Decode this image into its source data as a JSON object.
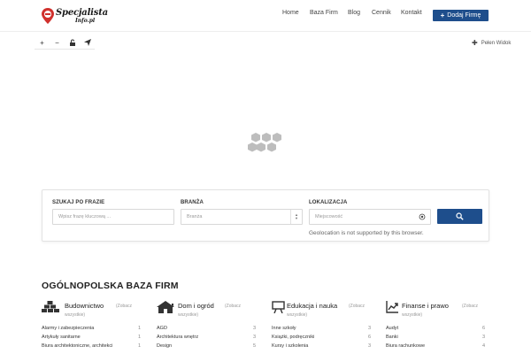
{
  "header": {
    "logo": {
      "line1": "Specjalista",
      "line2": "Info.pl"
    },
    "nav": [
      {
        "label": "Home"
      },
      {
        "label": "Baza Firm"
      },
      {
        "label": "Blog"
      },
      {
        "label": "Cennik"
      },
      {
        "label": "Kontakt"
      }
    ],
    "add_button": {
      "label": "Dodaj Firmę"
    }
  },
  "map": {
    "controls": [
      {
        "icon": "plus-icon",
        "glyph": "+"
      },
      {
        "icon": "minus-icon",
        "glyph": "−"
      },
      {
        "icon": "unlock-icon",
        "glyph": "🔓"
      },
      {
        "icon": "send-icon",
        "glyph": "➤"
      }
    ],
    "full_view_label": "Pełen Widok"
  },
  "search": {
    "phrase": {
      "label": "SZUKAJ PO FRAZIE",
      "placeholder": "Wpisz frazę kluczową ..."
    },
    "branch": {
      "label": "BRANŻA",
      "value": "Branża"
    },
    "location": {
      "label": "LOKALIZACJA",
      "placeholder": "Miejscowość"
    },
    "geo_message": "Geolocation is not supported by this browser."
  },
  "directory": {
    "title": "OGÓLNOPOLSKA BAZA FIRM",
    "categories": [
      {
        "name": "Budownictwo",
        "icon": "bricks-icon",
        "more": "(Zobacz",
        "more2": "wszystkie)",
        "items": [
          {
            "label": "Alarmy i zabezpieczenia",
            "count": "1"
          },
          {
            "label": "Artykuły sanitarne",
            "count": "1"
          },
          {
            "label": "Biura architektoniczne, architekci",
            "count": "1"
          }
        ]
      },
      {
        "name": "Dom i ogród",
        "icon": "house-icon",
        "more": "(Zobacz",
        "more2": "wszystkie)",
        "items": [
          {
            "label": "AGD",
            "count": "3"
          },
          {
            "label": "Architektura wnętrz",
            "count": "3"
          },
          {
            "label": "Design",
            "count": "5"
          }
        ]
      },
      {
        "name": "Edukacja i nauka",
        "icon": "board-icon",
        "more": "(Zobacz",
        "more2": "wszystkie)",
        "items": [
          {
            "label": "Inne szkoły",
            "count": "3"
          },
          {
            "label": "Książki, podręczniki",
            "count": "6"
          },
          {
            "label": "Kursy i szkolenia",
            "count": "3"
          }
        ]
      },
      {
        "name": "Finanse i prawo",
        "icon": "chart-up-icon",
        "more": "(Zobacz",
        "more2": "wszystkie)",
        "items": [
          {
            "label": "Audyt",
            "count": "6"
          },
          {
            "label": "Banki",
            "count": "3"
          },
          {
            "label": "Biura rachunkowe",
            "count": "4"
          }
        ]
      }
    ]
  },
  "colors": {
    "accent": "#1e4e8c",
    "logo_red": "#d0312d"
  }
}
